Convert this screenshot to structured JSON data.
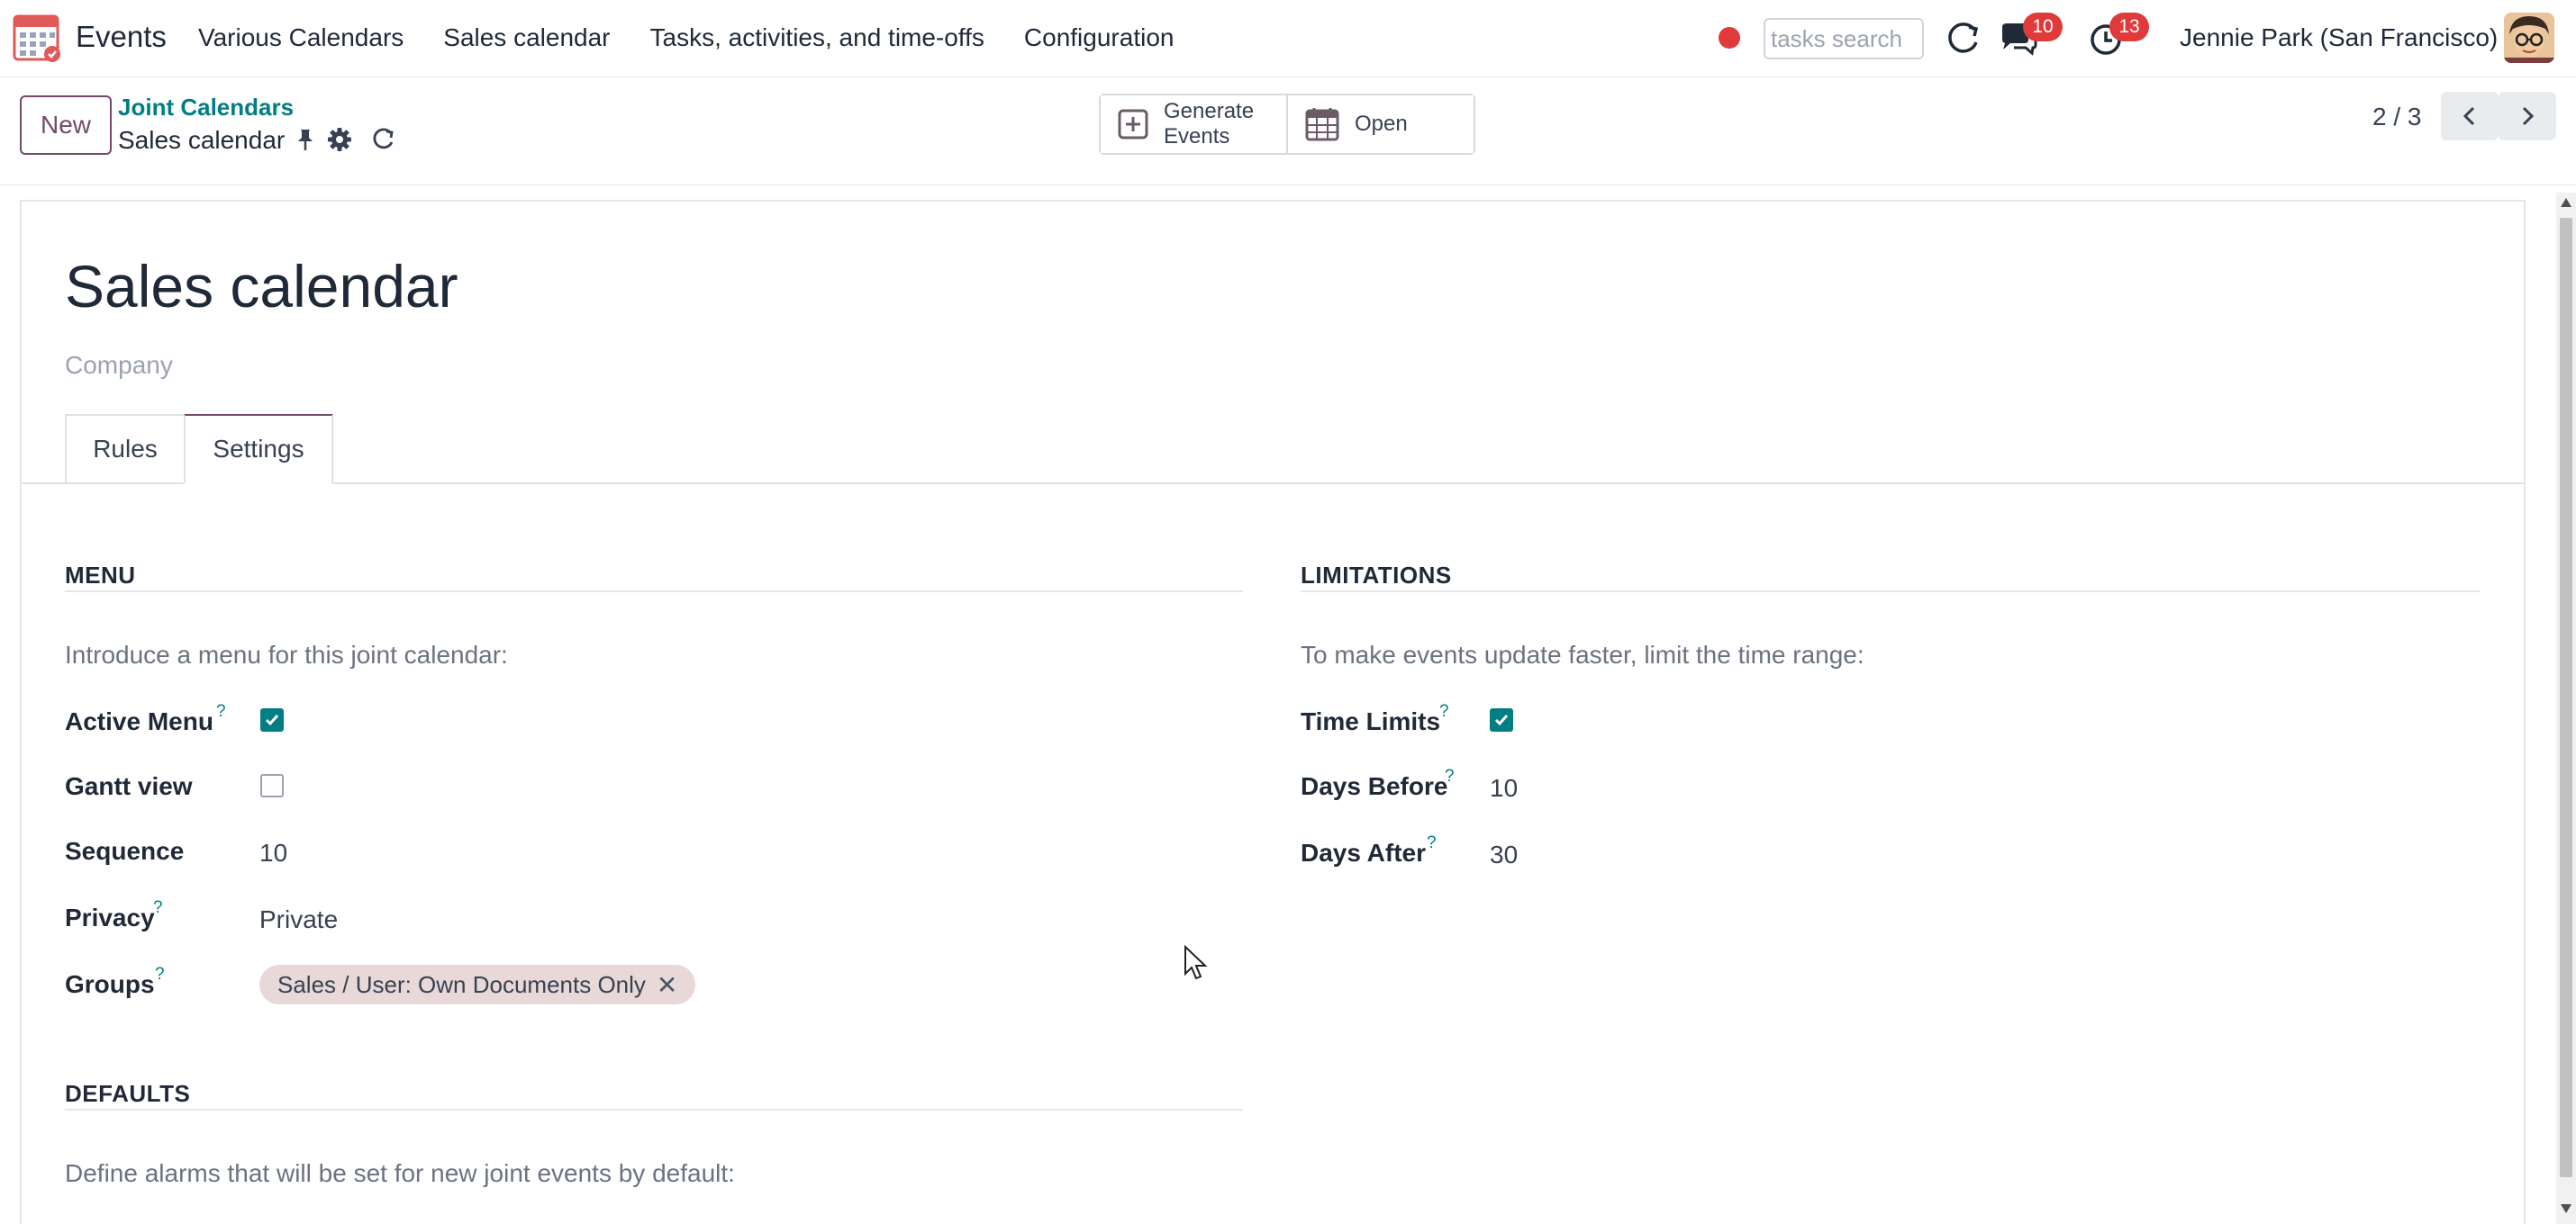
{
  "navbar": {
    "app_name": "Events",
    "menu": [
      "Various Calendars",
      "Sales calendar",
      "Tasks, activities, and time-offs",
      "Configuration"
    ],
    "search_placeholder": "tasks search",
    "messages_count": "10",
    "activities_count": "13",
    "user": "Jennie Park (San Francisco)",
    "icons": {
      "app": "calendar-app-icon",
      "record": "record-dot-icon",
      "sync": "sync-icon",
      "messages": "chat-icon",
      "activities": "clock-icon"
    }
  },
  "control_panel": {
    "new_label": "New",
    "breadcrumb_parent": "Joint Calendars",
    "breadcrumb_current": "Sales calendar",
    "actions": {
      "generate_label_1": "Generate",
      "generate_label_2": "Events",
      "open_label": "Open"
    },
    "pager": "2 / 3"
  },
  "record": {
    "title": "Sales calendar",
    "company_placeholder": "Company",
    "tabs": [
      "Rules",
      "Settings"
    ],
    "active_tab": "Settings"
  },
  "menu_section": {
    "title": "MENU",
    "description": "Introduce a menu for this joint calendar:",
    "fields": {
      "active_menu": {
        "label": "Active Menu",
        "help": "?",
        "checked": true
      },
      "gantt_view": {
        "label": "Gantt view",
        "checked": false
      },
      "sequence": {
        "label": "Sequence",
        "value": "10"
      },
      "privacy": {
        "label": "Privacy",
        "help": "?",
        "value": "Private"
      },
      "groups": {
        "label": "Groups",
        "help": "?",
        "tag": "Sales / User: Own Documents Only"
      }
    }
  },
  "limitations_section": {
    "title": "LIMITATIONS",
    "description": "To make events update faster, limit the time range:",
    "fields": {
      "time_limits": {
        "label": "Time Limits",
        "help": "?",
        "checked": true
      },
      "days_before": {
        "label": "Days Before",
        "help": "?",
        "value": "10"
      },
      "days_after": {
        "label": "Days After",
        "help": "?",
        "value": "30"
      }
    }
  },
  "defaults_section": {
    "title": "DEFAULTS",
    "description": "Define alarms that will be set for new joint events by default:"
  },
  "colors": {
    "brand": "#714b67",
    "teal": "#017e84",
    "badge": "#e03a3a",
    "tag_bg": "#e8d8d8"
  }
}
